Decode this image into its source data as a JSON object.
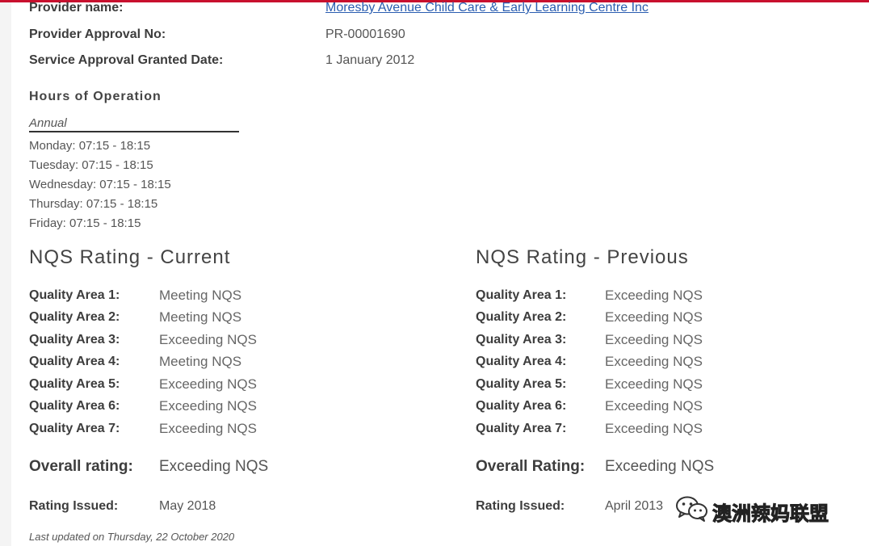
{
  "provider": {
    "name_label": "Provider name:",
    "name_value": "Moresby Avenue Child Care & Early Learning Centre Inc",
    "approval_label": "Provider Approval No:",
    "approval_value": "PR-00001690",
    "granted_label": "Service Approval Granted Date:",
    "granted_value": "1 January 2012"
  },
  "hours": {
    "title": "Hours of Operation",
    "period": "Annual",
    "days": [
      "Monday: 07:15 - 18:15",
      "Tuesday: 07:15 - 18:15",
      "Wednesday: 07:15 - 18:15",
      "Thursday: 07:15 - 18:15",
      "Friday: 07:15 - 18:15"
    ]
  },
  "nqs_current": {
    "title": "NQS Rating - Current",
    "areas": [
      {
        "label": "Quality Area 1:",
        "value": "Meeting NQS"
      },
      {
        "label": "Quality Area 2:",
        "value": "Meeting NQS"
      },
      {
        "label": "Quality Area 3:",
        "value": "Exceeding NQS"
      },
      {
        "label": "Quality Area 4:",
        "value": "Meeting NQS"
      },
      {
        "label": "Quality Area 5:",
        "value": "Exceeding NQS"
      },
      {
        "label": "Quality Area 6:",
        "value": "Exceeding NQS"
      },
      {
        "label": "Quality Area 7:",
        "value": "Exceeding NQS"
      }
    ],
    "overall_label": "Overall rating:",
    "overall_value": "Exceeding NQS",
    "issued_label": "Rating Issued:",
    "issued_value": "May 2018"
  },
  "nqs_previous": {
    "title": "NQS Rating - Previous",
    "areas": [
      {
        "label": "Quality Area 1:",
        "value": "Exceeding NQS"
      },
      {
        "label": "Quality Area 2:",
        "value": "Exceeding NQS"
      },
      {
        "label": "Quality Area 3:",
        "value": "Exceeding NQS"
      },
      {
        "label": "Quality Area 4:",
        "value": "Exceeding NQS"
      },
      {
        "label": "Quality Area 5:",
        "value": "Exceeding NQS"
      },
      {
        "label": "Quality Area 6:",
        "value": "Exceeding NQS"
      },
      {
        "label": "Quality Area 7:",
        "value": "Exceeding NQS"
      }
    ],
    "overall_label": "Overall Rating:",
    "overall_value": "Exceeding NQS",
    "issued_label": "Rating Issued:",
    "issued_value": "April 2013"
  },
  "last_updated": "Last updated on Thursday, 22 October 2020",
  "watermark": {
    "text": "澳洲辣妈联盟",
    "icon": "wechat-icon"
  },
  "colors": {
    "accent": "#c8102e",
    "link": "#2a5db0"
  }
}
